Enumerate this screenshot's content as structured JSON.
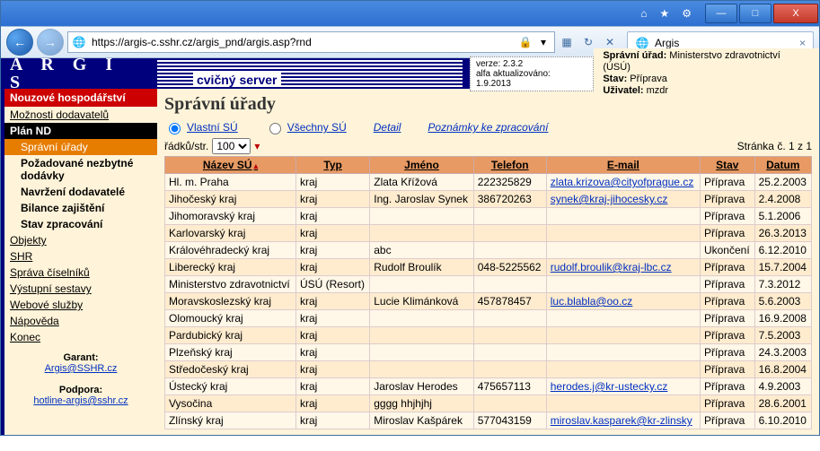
{
  "browser": {
    "url": "https://argis-c.sshr.cz/argis_pnd/argis.asp?rnd",
    "tab_title": "Argis",
    "btn_min": "—",
    "btn_max": "□",
    "btn_close": "X"
  },
  "header": {
    "logo": "A R G I S",
    "server_label": "cvičný server",
    "version_label": "verze:",
    "version": "2.3.2",
    "updated_label": "alfa aktualizováno:",
    "updated": "1.9.2013",
    "meta_office_label": "Správní úřad:",
    "meta_office": "Ministerstvo zdravotnictví (ÚSÚ)",
    "meta_state_label": "Stav:",
    "meta_state": "Příprava",
    "meta_user_label": "Uživatel:",
    "meta_user": "mzdr"
  },
  "nav": {
    "nh": "Nouzové hospodářství",
    "moznosti": "Možnosti dodavatelů",
    "plan": "Plán ND",
    "sub": {
      "spravni": "Správní úřady",
      "pozadovane": "Požadované nezbytné dodávky",
      "navrzeni": "Navržení dodavatelé",
      "bilance": "Bilance zajištění",
      "stav": "Stav zpracování"
    },
    "objekty": "Objekty",
    "shr": "SHR",
    "sprava": "Správa číselníků",
    "vystupni": "Výstupní sestavy",
    "webove": "Webové služby",
    "napoveda": "Nápověda",
    "konec": "Konec",
    "garant_label": "Garant:",
    "garant_mail": "Argis@SSHR.cz",
    "podpora_label": "Podpora:",
    "podpora_mail": "hotline-argis@sshr.cz"
  },
  "main": {
    "title": "Správní úřady",
    "radio_own": "Vlastní SÚ",
    "radio_all": "Všechny SÚ",
    "detail": "Detail",
    "notes": "Poznámky ke zpracování",
    "rows_label": "řádků/str.",
    "rows_value": "100",
    "page_info": "Stránka č. 1 z 1",
    "cols": {
      "name": "Název SÚ",
      "type": "Typ",
      "person": "Jméno",
      "phone": "Telefon",
      "email": "E-mail",
      "state": "Stav",
      "date": "Datum"
    },
    "rows": [
      {
        "name": "Hl. m. Praha",
        "type": "kraj",
        "person": "Zlata Křížová",
        "phone": "222325829",
        "email": "zlata.krizova@cityofprague.cz",
        "state": "Příprava",
        "date": "25.2.2003"
      },
      {
        "name": "Jihočeský kraj",
        "type": "kraj",
        "person": "Ing. Jaroslav Synek",
        "phone": "386720263",
        "email": "synek@kraj-jihocesky.cz",
        "state": "Příprava",
        "date": "2.4.2008"
      },
      {
        "name": "Jihomoravský kraj",
        "type": "kraj",
        "person": "",
        "phone": "",
        "email": "",
        "state": "Příprava",
        "date": "5.1.2006"
      },
      {
        "name": "Karlovarský kraj",
        "type": "kraj",
        "person": "",
        "phone": "",
        "email": "",
        "state": "Příprava",
        "date": "26.3.2013"
      },
      {
        "name": "Královéhradecký kraj",
        "type": "kraj",
        "person": "abc",
        "phone": "",
        "email": "",
        "state": "Ukončení",
        "date": "6.12.2010"
      },
      {
        "name": "Liberecký kraj",
        "type": "kraj",
        "person": "Rudolf Broulík",
        "phone": "048-5225562",
        "email": "rudolf.broulik@kraj-lbc.cz",
        "state": "Příprava",
        "date": "15.7.2004"
      },
      {
        "name": "Ministerstvo zdravotnictví",
        "type": "ÚSÚ (Resort)",
        "person": "",
        "phone": "",
        "email": "",
        "state": "Příprava",
        "date": "7.3.2012"
      },
      {
        "name": "Moravskoslezský kraj",
        "type": "kraj",
        "person": "Lucie Klimánková",
        "phone": "457878457",
        "email": "luc.blabla@oo.cz",
        "state": "Příprava",
        "date": "5.6.2003"
      },
      {
        "name": "Olomoucký kraj",
        "type": "kraj",
        "person": "",
        "phone": "",
        "email": "",
        "state": "Příprava",
        "date": "16.9.2008"
      },
      {
        "name": "Pardubický kraj",
        "type": "kraj",
        "person": "",
        "phone": "",
        "email": "",
        "state": "Příprava",
        "date": "7.5.2003"
      },
      {
        "name": "Plzeňský kraj",
        "type": "kraj",
        "person": "",
        "phone": "",
        "email": "",
        "state": "Příprava",
        "date": "24.3.2003"
      },
      {
        "name": "Středočeský kraj",
        "type": "kraj",
        "person": "",
        "phone": "",
        "email": "",
        "state": "Příprava",
        "date": "16.8.2004"
      },
      {
        "name": "Ústecký kraj",
        "type": "kraj",
        "person": "Jaroslav Herodes",
        "phone": "475657113",
        "email": "herodes.j@kr-ustecky.cz",
        "state": "Příprava",
        "date": "4.9.2003"
      },
      {
        "name": "Vysočina",
        "type": "kraj",
        "person": "gggg hhjhjhj",
        "phone": "",
        "email": "",
        "state": "Příprava",
        "date": "28.6.2001"
      },
      {
        "name": "Zlínský kraj",
        "type": "kraj",
        "person": "Miroslav Kašpárek",
        "phone": "577043159",
        "email": "miroslav.kasparek@kr-zlinsky",
        "state": "Příprava",
        "date": "6.10.2010"
      }
    ]
  }
}
